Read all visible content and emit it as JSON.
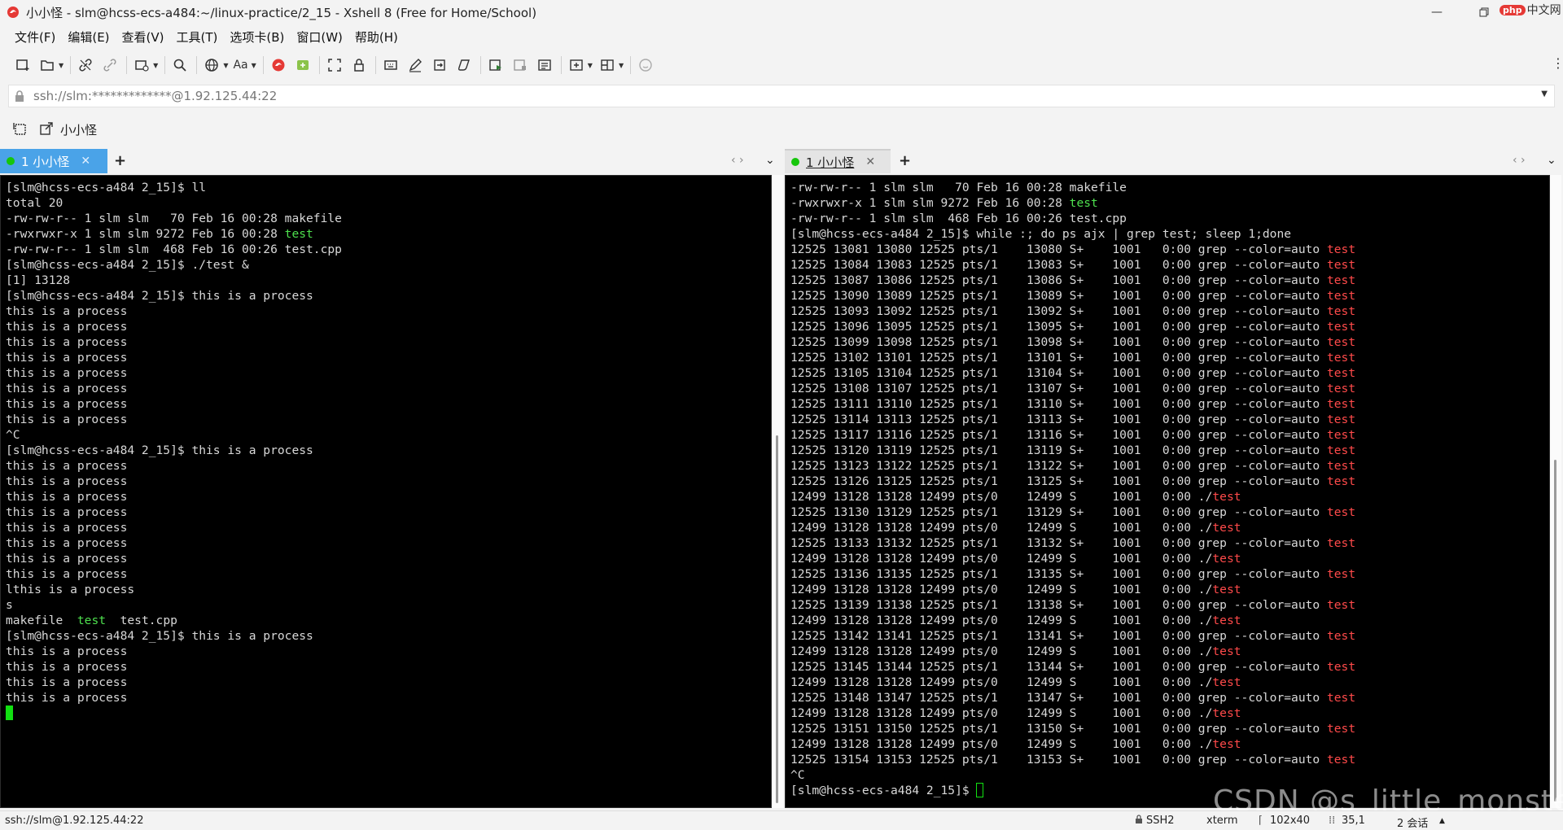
{
  "window": {
    "title": "小小怪 - slm@hcss-ecs-a484:~/linux-practice/2_15 - Xshell 8 (Free for Home/School)",
    "corner_logo": "中文网",
    "corner_logo_badge": "php"
  },
  "menu": [
    "文件(F)",
    "编辑(E)",
    "查看(V)",
    "工具(T)",
    "选项卡(B)",
    "窗口(W)",
    "帮助(H)"
  ],
  "toolbar": {
    "font_label": "Aa"
  },
  "address": {
    "text": "ssh://slm:*************@1.92.125.44:22"
  },
  "session_bar": {
    "name": "小小怪"
  },
  "left_tab": {
    "label": "1 小小怪",
    "close": "✕",
    "add": "+"
  },
  "right_tab": {
    "label": "1 小小怪",
    "close": "✕",
    "add": "+"
  },
  "colors": {
    "active_tab": "#4aa3e8",
    "terminal_bg": "#000000",
    "green": "#4ee04e",
    "red": "#ff4a4a",
    "status_dot": "#16c60c"
  },
  "left_terminal": [
    [
      [
        "[slm@hcss-ecs-a484 2_15]$ ll",
        ""
      ]
    ],
    [
      [
        "total 20",
        ""
      ]
    ],
    [
      [
        "-rw-rw-r-- 1 slm slm   70 Feb 16 00:28 makefile",
        ""
      ]
    ],
    [
      [
        "-rwxrwxr-x 1 slm slm 9272 Feb 16 00:28 ",
        ""
      ],
      [
        "test",
        "green"
      ]
    ],
    [
      [
        "-rw-rw-r-- 1 slm slm  468 Feb 16 00:26 test.cpp",
        ""
      ]
    ],
    [
      [
        "[slm@hcss-ecs-a484 2_15]$ ./test &",
        ""
      ]
    ],
    [
      [
        "[1] 13128",
        ""
      ]
    ],
    [
      [
        "[slm@hcss-ecs-a484 2_15]$ this is a process",
        ""
      ]
    ],
    [
      [
        "this is a process",
        ""
      ]
    ],
    [
      [
        "this is a process",
        ""
      ]
    ],
    [
      [
        "this is a process",
        ""
      ]
    ],
    [
      [
        "this is a process",
        ""
      ]
    ],
    [
      [
        "this is a process",
        ""
      ]
    ],
    [
      [
        "this is a process",
        ""
      ]
    ],
    [
      [
        "this is a process",
        ""
      ]
    ],
    [
      [
        "this is a process",
        ""
      ]
    ],
    [
      [
        "^C",
        ""
      ]
    ],
    [
      [
        "[slm@hcss-ecs-a484 2_15]$ this is a process",
        ""
      ]
    ],
    [
      [
        "this is a process",
        ""
      ]
    ],
    [
      [
        "this is a process",
        ""
      ]
    ],
    [
      [
        "this is a process",
        ""
      ]
    ],
    [
      [
        "this is a process",
        ""
      ]
    ],
    [
      [
        "this is a process",
        ""
      ]
    ],
    [
      [
        "this is a process",
        ""
      ]
    ],
    [
      [
        "this is a process",
        ""
      ]
    ],
    [
      [
        "this is a process",
        ""
      ]
    ],
    [
      [
        "lthis is a process",
        ""
      ]
    ],
    [
      [
        "s",
        ""
      ]
    ],
    [
      [
        "makefile  ",
        ""
      ],
      [
        "test",
        "green"
      ],
      [
        "  test.cpp",
        ""
      ]
    ],
    [
      [
        "[slm@hcss-ecs-a484 2_15]$ this is a process",
        ""
      ]
    ],
    [
      [
        "this is a process",
        ""
      ]
    ],
    [
      [
        "this is a process",
        ""
      ]
    ],
    [
      [
        "this is a process",
        ""
      ]
    ],
    [
      [
        "this is a process",
        ""
      ]
    ],
    [
      [
        "",
        "cursor"
      ]
    ]
  ],
  "right_terminal": [
    [
      [
        "-rw-rw-r-- 1 slm slm   70 Feb 16 00:28 makefile",
        ""
      ]
    ],
    [
      [
        "-rwxrwxr-x 1 slm slm 9272 Feb 16 00:28 ",
        ""
      ],
      [
        "test",
        "green"
      ]
    ],
    [
      [
        "-rw-rw-r-- 1 slm slm  468 Feb 16 00:26 test.cpp",
        ""
      ]
    ],
    [
      [
        "[slm@hcss-ecs-a484 2_15]$ while :; do ps ajx | grep test; sleep 1;done",
        ""
      ]
    ],
    [
      [
        "12525 13081 13080 12525 pts/1    13080 S+    1001   0:00 grep --color=auto ",
        ""
      ],
      [
        "test",
        "red"
      ]
    ],
    [
      [
        "12525 13084 13083 12525 pts/1    13083 S+    1001   0:00 grep --color=auto ",
        ""
      ],
      [
        "test",
        "red"
      ]
    ],
    [
      [
        "12525 13087 13086 12525 pts/1    13086 S+    1001   0:00 grep --color=auto ",
        ""
      ],
      [
        "test",
        "red"
      ]
    ],
    [
      [
        "12525 13090 13089 12525 pts/1    13089 S+    1001   0:00 grep --color=auto ",
        ""
      ],
      [
        "test",
        "red"
      ]
    ],
    [
      [
        "12525 13093 13092 12525 pts/1    13092 S+    1001   0:00 grep --color=auto ",
        ""
      ],
      [
        "test",
        "red"
      ]
    ],
    [
      [
        "12525 13096 13095 12525 pts/1    13095 S+    1001   0:00 grep --color=auto ",
        ""
      ],
      [
        "test",
        "red"
      ]
    ],
    [
      [
        "12525 13099 13098 12525 pts/1    13098 S+    1001   0:00 grep --color=auto ",
        ""
      ],
      [
        "test",
        "red"
      ]
    ],
    [
      [
        "12525 13102 13101 12525 pts/1    13101 S+    1001   0:00 grep --color=auto ",
        ""
      ],
      [
        "test",
        "red"
      ]
    ],
    [
      [
        "12525 13105 13104 12525 pts/1    13104 S+    1001   0:00 grep --color=auto ",
        ""
      ],
      [
        "test",
        "red"
      ]
    ],
    [
      [
        "12525 13108 13107 12525 pts/1    13107 S+    1001   0:00 grep --color=auto ",
        ""
      ],
      [
        "test",
        "red"
      ]
    ],
    [
      [
        "12525 13111 13110 12525 pts/1    13110 S+    1001   0:00 grep --color=auto ",
        ""
      ],
      [
        "test",
        "red"
      ]
    ],
    [
      [
        "12525 13114 13113 12525 pts/1    13113 S+    1001   0:00 grep --color=auto ",
        ""
      ],
      [
        "test",
        "red"
      ]
    ],
    [
      [
        "12525 13117 13116 12525 pts/1    13116 S+    1001   0:00 grep --color=auto ",
        ""
      ],
      [
        "test",
        "red"
      ]
    ],
    [
      [
        "12525 13120 13119 12525 pts/1    13119 S+    1001   0:00 grep --color=auto ",
        ""
      ],
      [
        "test",
        "red"
      ]
    ],
    [
      [
        "12525 13123 13122 12525 pts/1    13122 S+    1001   0:00 grep --color=auto ",
        ""
      ],
      [
        "test",
        "red"
      ]
    ],
    [
      [
        "12525 13126 13125 12525 pts/1    13125 S+    1001   0:00 grep --color=auto ",
        ""
      ],
      [
        "test",
        "red"
      ]
    ],
    [
      [
        "12499 13128 13128 12499 pts/0    12499 S     1001   0:00 ./",
        ""
      ],
      [
        "test",
        "red"
      ]
    ],
    [
      [
        "12525 13130 13129 12525 pts/1    13129 S+    1001   0:00 grep --color=auto ",
        ""
      ],
      [
        "test",
        "red"
      ]
    ],
    [
      [
        "12499 13128 13128 12499 pts/0    12499 S     1001   0:00 ./",
        ""
      ],
      [
        "test",
        "red"
      ]
    ],
    [
      [
        "12525 13133 13132 12525 pts/1    13132 S+    1001   0:00 grep --color=auto ",
        ""
      ],
      [
        "test",
        "red"
      ]
    ],
    [
      [
        "12499 13128 13128 12499 pts/0    12499 S     1001   0:00 ./",
        ""
      ],
      [
        "test",
        "red"
      ]
    ],
    [
      [
        "12525 13136 13135 12525 pts/1    13135 S+    1001   0:00 grep --color=auto ",
        ""
      ],
      [
        "test",
        "red"
      ]
    ],
    [
      [
        "12499 13128 13128 12499 pts/0    12499 S     1001   0:00 ./",
        ""
      ],
      [
        "test",
        "red"
      ]
    ],
    [
      [
        "12525 13139 13138 12525 pts/1    13138 S+    1001   0:00 grep --color=auto ",
        ""
      ],
      [
        "test",
        "red"
      ]
    ],
    [
      [
        "12499 13128 13128 12499 pts/0    12499 S     1001   0:00 ./",
        ""
      ],
      [
        "test",
        "red"
      ]
    ],
    [
      [
        "12525 13142 13141 12525 pts/1    13141 S+    1001   0:00 grep --color=auto ",
        ""
      ],
      [
        "test",
        "red"
      ]
    ],
    [
      [
        "12499 13128 13128 12499 pts/0    12499 S     1001   0:00 ./",
        ""
      ],
      [
        "test",
        "red"
      ]
    ],
    [
      [
        "12525 13145 13144 12525 pts/1    13144 S+    1001   0:00 grep --color=auto ",
        ""
      ],
      [
        "test",
        "red"
      ]
    ],
    [
      [
        "12499 13128 13128 12499 pts/0    12499 S     1001   0:00 ./",
        ""
      ],
      [
        "test",
        "red"
      ]
    ],
    [
      [
        "12525 13148 13147 12525 pts/1    13147 S+    1001   0:00 grep --color=auto ",
        ""
      ],
      [
        "test",
        "red"
      ]
    ],
    [
      [
        "12499 13128 13128 12499 pts/0    12499 S     1001   0:00 ./",
        ""
      ],
      [
        "test",
        "red"
      ]
    ],
    [
      [
        "12525 13151 13150 12525 pts/1    13150 S+    1001   0:00 grep --color=auto ",
        ""
      ],
      [
        "test",
        "red"
      ]
    ],
    [
      [
        "12499 13128 13128 12499 pts/0    12499 S     1001   0:00 ./",
        ""
      ],
      [
        "test",
        "red"
      ]
    ],
    [
      [
        "12525 13154 13153 12525 pts/1    13153 S+    1001   0:00 grep --color=auto ",
        ""
      ],
      [
        "test",
        "red"
      ]
    ],
    [
      [
        "^C",
        ""
      ]
    ],
    [
      [
        "[slm@hcss-ecs-a484 2_15]$ ",
        ""
      ],
      [
        "",
        "cursor-hollow"
      ]
    ]
  ],
  "statusbar": {
    "connection": "ssh://slm@1.92.125.44:22",
    "protocol": "SSH2",
    "term": "xterm",
    "size": "102x40",
    "pos": "35,1",
    "sessions": "2 会话"
  },
  "watermark": "CSDN @s_little_monster_"
}
